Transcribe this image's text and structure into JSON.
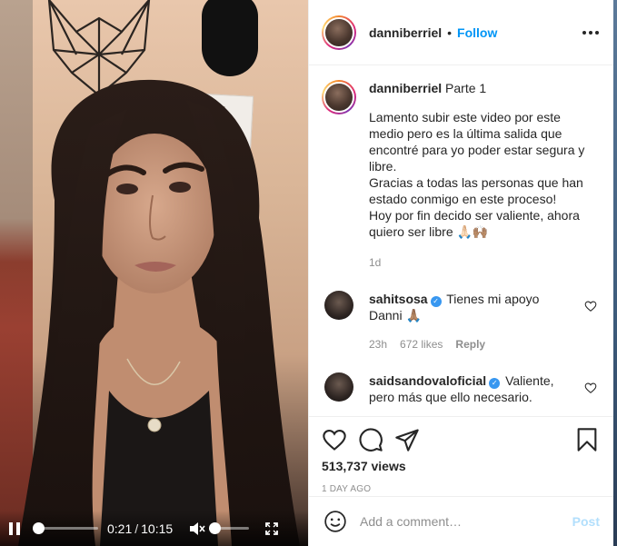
{
  "video": {
    "current_time": "0:21",
    "separator": "/",
    "duration": "10:15",
    "progress": 0.034,
    "volume": 0.0,
    "muted": true
  },
  "header": {
    "username": "danniberriel",
    "dot": "•",
    "follow_label": "Follow"
  },
  "caption": {
    "username": "danniberriel",
    "title": "Parte 1",
    "text": "Lamento subir este video por este medio pero es la última salida que encontré para yo poder estar segura y libre.\nGracias a todas las personas que han estado conmigo en este proceso!\nHoy por fin decido ser valiente, ahora quiero ser libre 🙏🏻🙌🏽",
    "age": "1d"
  },
  "comments": [
    {
      "username": "sahitsosa",
      "verified": true,
      "text": "Tienes mi apoyo Danni 🙏🏽",
      "age": "23h",
      "likes": "672 likes",
      "reply_label": "Reply"
    },
    {
      "username": "saidsandovaloficial",
      "verified": true,
      "text": "Valiente, pero más que ello necesario.",
      "age": "",
      "likes": "",
      "reply_label": ""
    }
  ],
  "stats": {
    "views": "513,737 views",
    "date": "1 DAY AGO"
  },
  "add_comment": {
    "placeholder": "Add a comment…",
    "post_label": "Post"
  },
  "colors": {
    "link_blue": "#0095f6",
    "verified_blue": "#3897f0",
    "muted_text": "#8e8e8e",
    "post_disabled": "#b2dffc"
  },
  "icons": {
    "like": "heart-icon",
    "comment": "comment-icon",
    "share": "paper-plane-icon",
    "save": "bookmark-icon",
    "emoji": "smiley-icon",
    "more": "ellipsis-icon",
    "pause": "pause-icon",
    "volume": "volume-muted-icon",
    "fullscreen": "fullscreen-icon"
  }
}
